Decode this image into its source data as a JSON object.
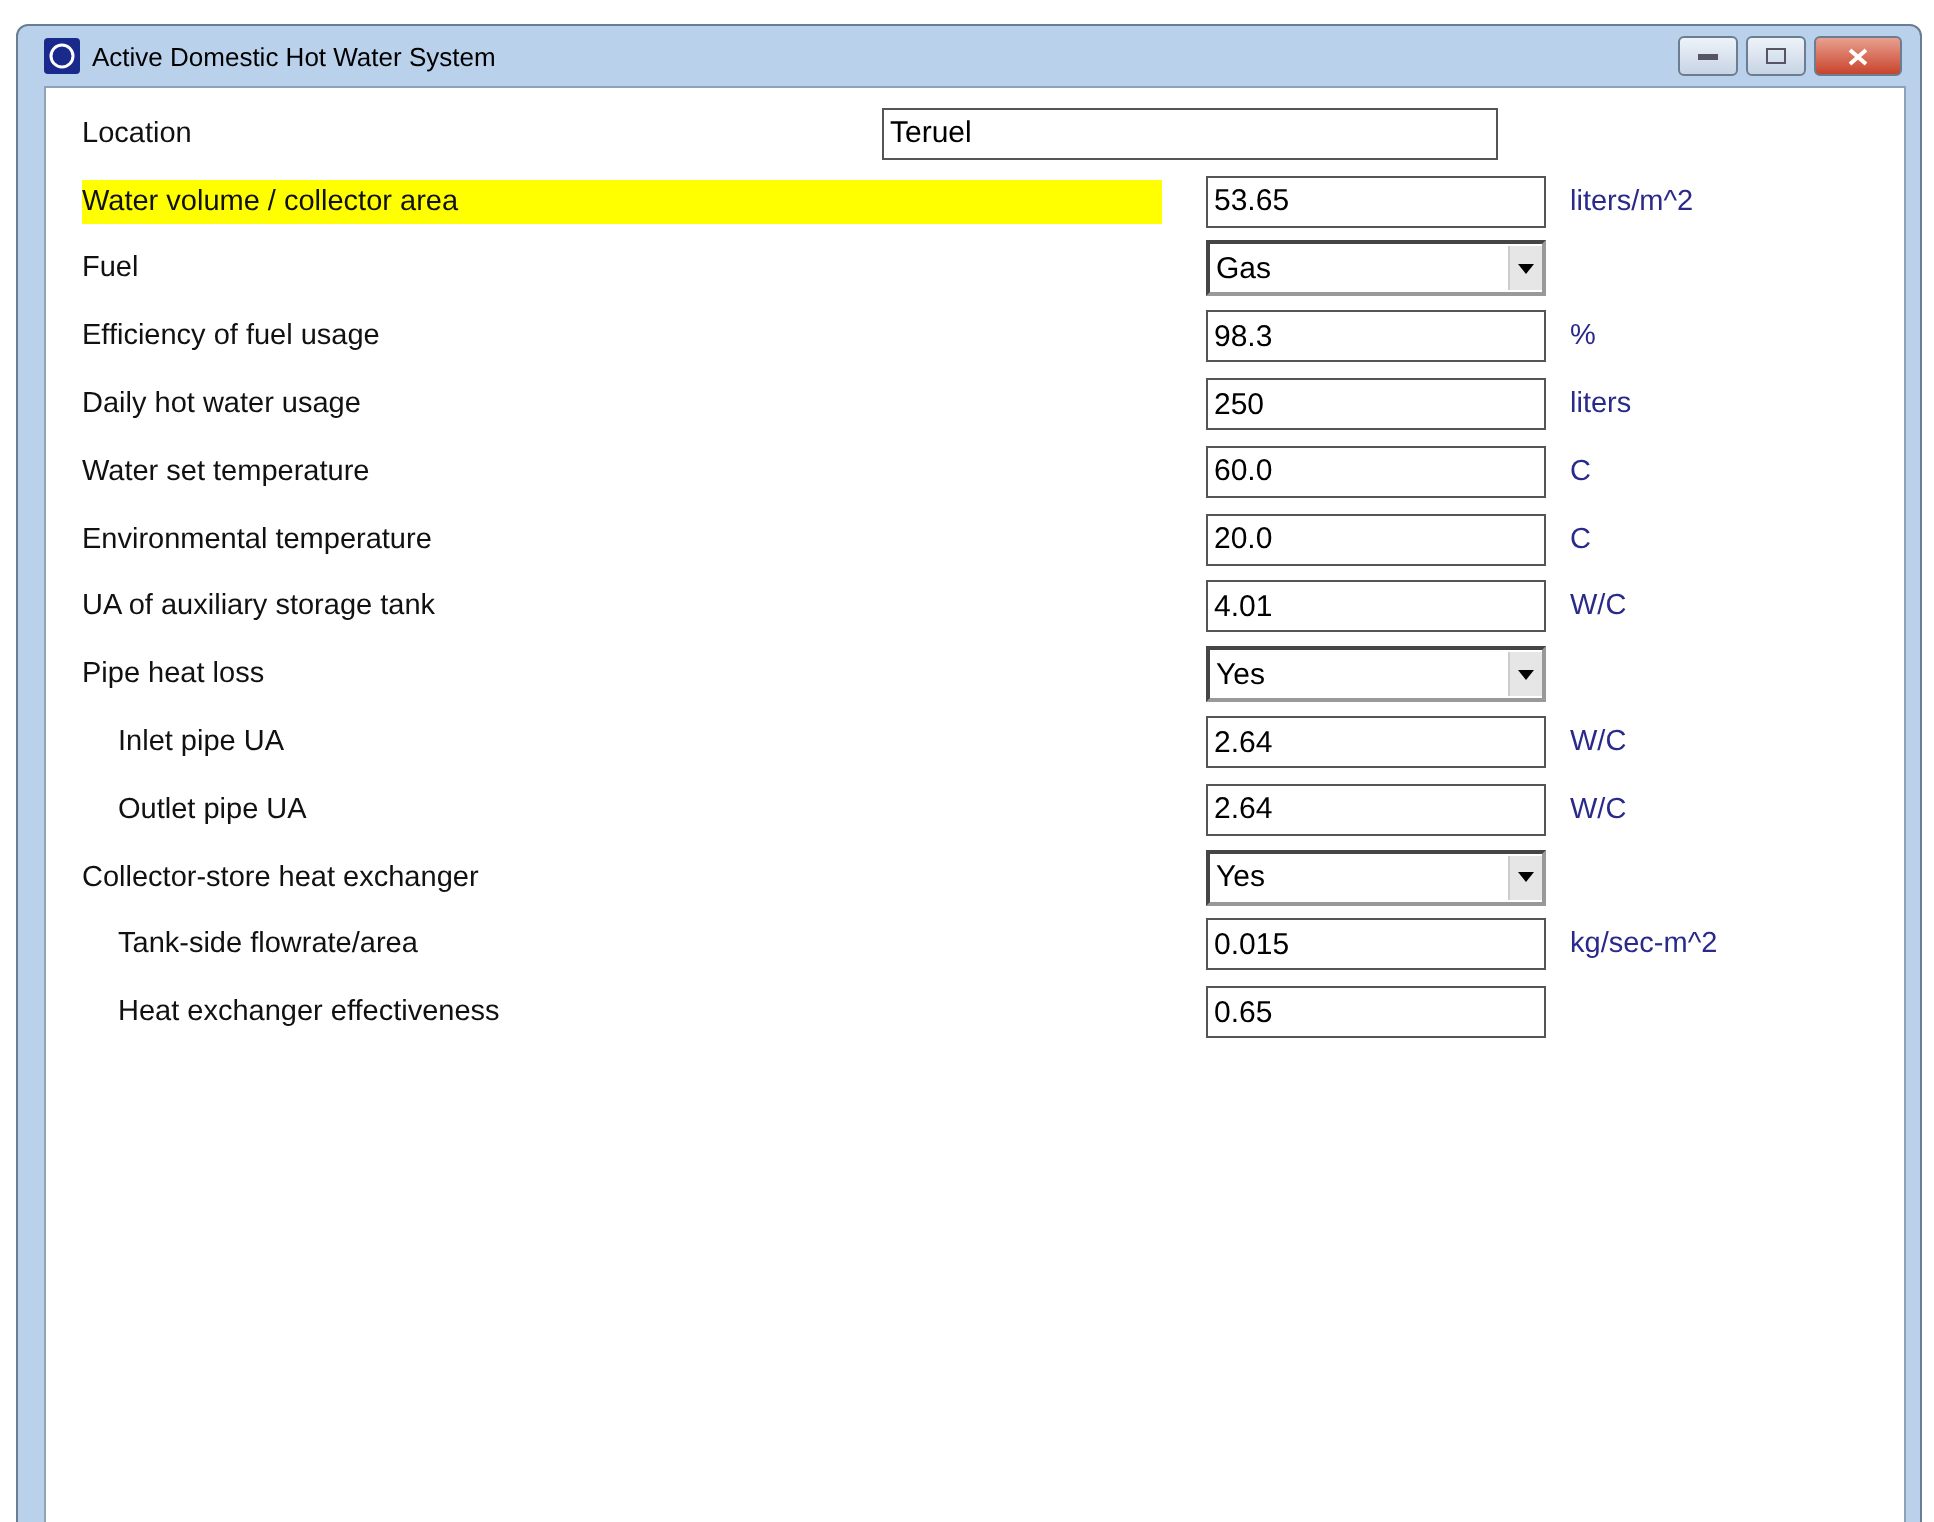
{
  "window": {
    "title": "Active Domestic Hot Water System"
  },
  "rows": [
    {
      "kind": "wide",
      "label": "Location",
      "value": "Teruel",
      "highlighted": false
    },
    {
      "kind": "text",
      "label": "Water volume / collector area",
      "value": "53.65",
      "unit": "liters/m^2",
      "highlighted": true
    },
    {
      "kind": "dropdown",
      "label": "Fuel",
      "value": "Gas",
      "highlighted": false
    },
    {
      "kind": "text",
      "label": "Efficiency of fuel usage",
      "value": "98.3",
      "unit": "%",
      "highlighted": false
    },
    {
      "kind": "text",
      "label": "Daily hot water usage",
      "value": "250",
      "unit": "liters",
      "highlighted": false
    },
    {
      "kind": "text",
      "label": "Water set temperature",
      "value": "60.0",
      "unit": "C",
      "highlighted": false
    },
    {
      "kind": "text",
      "label": "Environmental temperature",
      "value": "20.0",
      "unit": "C",
      "highlighted": false
    },
    {
      "kind": "text",
      "label": "UA of auxiliary storage tank",
      "value": "4.01",
      "unit": "W/C",
      "highlighted": false
    },
    {
      "kind": "dropdown",
      "label": "Pipe heat loss",
      "value": "Yes",
      "highlighted": false,
      "children": [
        {
          "kind": "text",
          "label": "Inlet pipe UA",
          "value": "2.64",
          "unit": "W/C",
          "highlighted": false
        },
        {
          "kind": "text",
          "label": "Outlet pipe UA",
          "value": "2.64",
          "unit": "W/C",
          "highlighted": false
        }
      ]
    },
    {
      "kind": "dropdown",
      "label": "Collector-store heat exchanger",
      "value": "Yes",
      "highlighted": false,
      "children": [
        {
          "kind": "text",
          "label": "Tank-side flowrate/area",
          "value": "0.015",
          "unit": "kg/sec-m^2",
          "highlighted": false
        },
        {
          "kind": "text",
          "label": "Heat exchanger effectiveness",
          "value": "0.65",
          "highlighted": false
        }
      ]
    }
  ]
}
